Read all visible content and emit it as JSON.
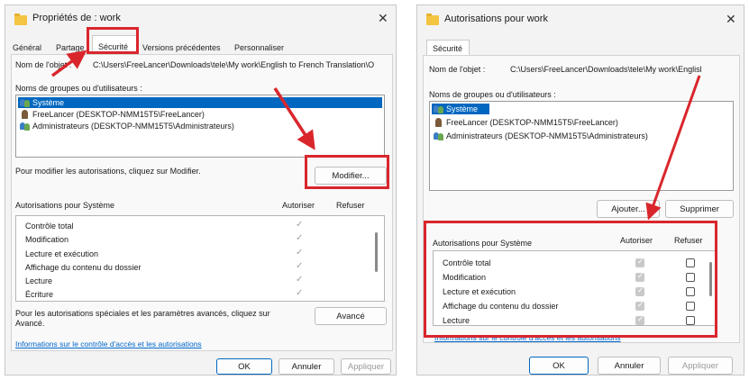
{
  "left": {
    "title": "Propriétés de : work",
    "tabs": [
      "Général",
      "Partage",
      "Sécurité",
      "Versions précédentes",
      "Personnaliser"
    ],
    "object_label": "Nom de l'objet :",
    "object_path": "C:\\Users\\FreeLancer\\Downloads\\tele\\My work\\English to French Translation\\O",
    "groups_label": "Noms de groupes ou d'utilisateurs :",
    "users": [
      "Système",
      "FreeLancer (DESKTOP-NMM15T5\\FreeLancer)",
      "Administrateurs (DESKTOP-NMM15T5\\Administrateurs)"
    ],
    "modify_text": "Pour modifier les autorisations, cliquez sur Modifier.",
    "modify_button": "Modifier...",
    "perms_label": "Autorisations pour Système",
    "allow_header": "Autoriser",
    "deny_header": "Refuser",
    "permissions": [
      "Contrôle total",
      "Modification",
      "Lecture et exécution",
      "Affichage du contenu du dossier",
      "Lecture",
      "Écriture"
    ],
    "advanced_text_1": "Pour les autorisations spéciales et les paramètres avancés, cliquez sur",
    "advanced_text_2": "Avancé.",
    "advanced_button": "Avancé",
    "info_link": "Informations sur le contrôle d'accès et les autorisations",
    "ok": "OK",
    "cancel": "Annuler",
    "apply": "Appliquer"
  },
  "right": {
    "title": "Autorisations pour work",
    "tab": "Sécurité",
    "object_label": "Nom de l'objet :",
    "object_path": "C:\\Users\\FreeLancer\\Downloads\\tele\\My work\\Englisl",
    "groups_label": "Noms de groupes ou d'utilisateurs :",
    "users": [
      "Système",
      "FreeLancer (DESKTOP-NMM15T5\\FreeLancer)",
      "Administrateurs (DESKTOP-NMM15T5\\Administrateurs)"
    ],
    "add_button": "Ajouter...",
    "remove_button": "Supprimer",
    "perms_label": "Autorisations pour Système",
    "allow_header": "Autoriser",
    "deny_header": "Refuser",
    "permissions": [
      "Contrôle total",
      "Modification",
      "Lecture et exécution",
      "Affichage du contenu du dossier",
      "Lecture"
    ],
    "info_link": "Informations sur le contrôle d'accès et les autorisations",
    "ok": "OK",
    "cancel": "Annuler",
    "apply": "Appliquer"
  },
  "colors": {
    "highlight": "#0067c0",
    "annotation": "#d9262c",
    "link": "#0066cc"
  }
}
